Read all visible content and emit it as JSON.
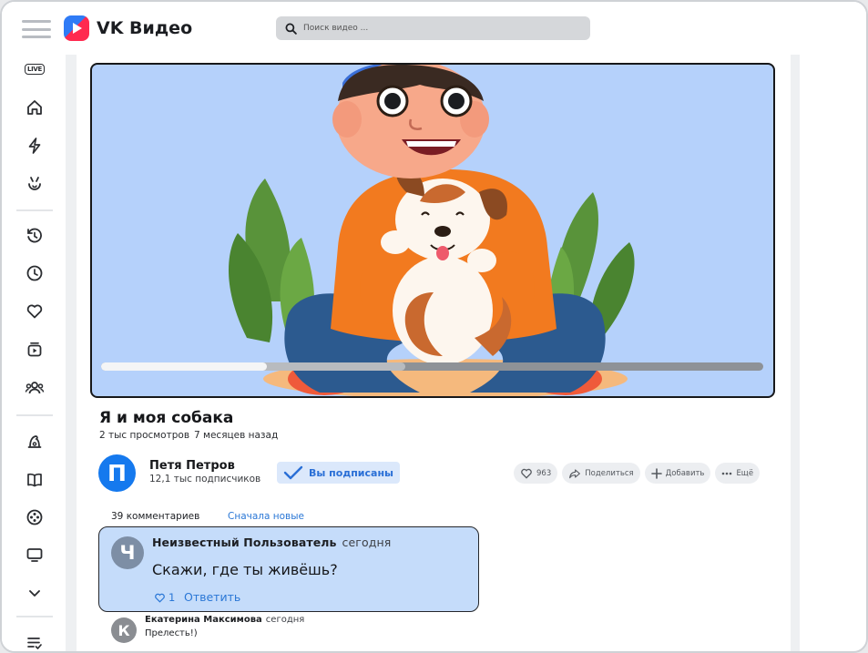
{
  "app": {
    "logo_text": "VK Видео"
  },
  "search": {
    "placeholder": "Поиск видео ..."
  },
  "sidebar": {
    "live_label": "LIVE",
    "items": [
      "live-icon",
      "home-icon",
      "lightning-icon",
      "hand-icon",
      "history-icon",
      "clock-icon",
      "heart-icon",
      "subscriptions-icon",
      "friends-icon",
      "hat-icon",
      "book-icon",
      "film-reel-icon",
      "tv-icon",
      "chevron-down-icon",
      "playlist-icon"
    ]
  },
  "video": {
    "title": "Я и моя собака",
    "views": "2 тыс просмотров",
    "age": "7 месяцев назад",
    "progress_played": 0.25,
    "progress_buffered": 0.46
  },
  "channel": {
    "avatar_letter": "П",
    "name": "Петя Петров",
    "subscribers": "12,1 тыс подписчиков",
    "subscribed_label": "Вы подписаны"
  },
  "actions": {
    "likes": "963",
    "share": "Поделиться",
    "add": "Добавить",
    "more": "Ещё"
  },
  "comments": {
    "count": "39 комментариев",
    "sort": "Сначала новые",
    "items": [
      {
        "avatar_letter": "Ч",
        "author": "Неизвестный Пользователь",
        "time": "сегодня",
        "text": "Скажи, где ты живёшь?",
        "likes": "1",
        "reply": "Ответить"
      },
      {
        "avatar_letter": "К",
        "author": "Екатерина Максимова",
        "time": "сегодня",
        "text": "Прелесть!)"
      }
    ]
  },
  "colors": {
    "accent": "#2a77d6",
    "avatar_channel": "#1579ee",
    "highlight_comment": "#c5dcfa",
    "video_bg": "#b5d1fb"
  }
}
